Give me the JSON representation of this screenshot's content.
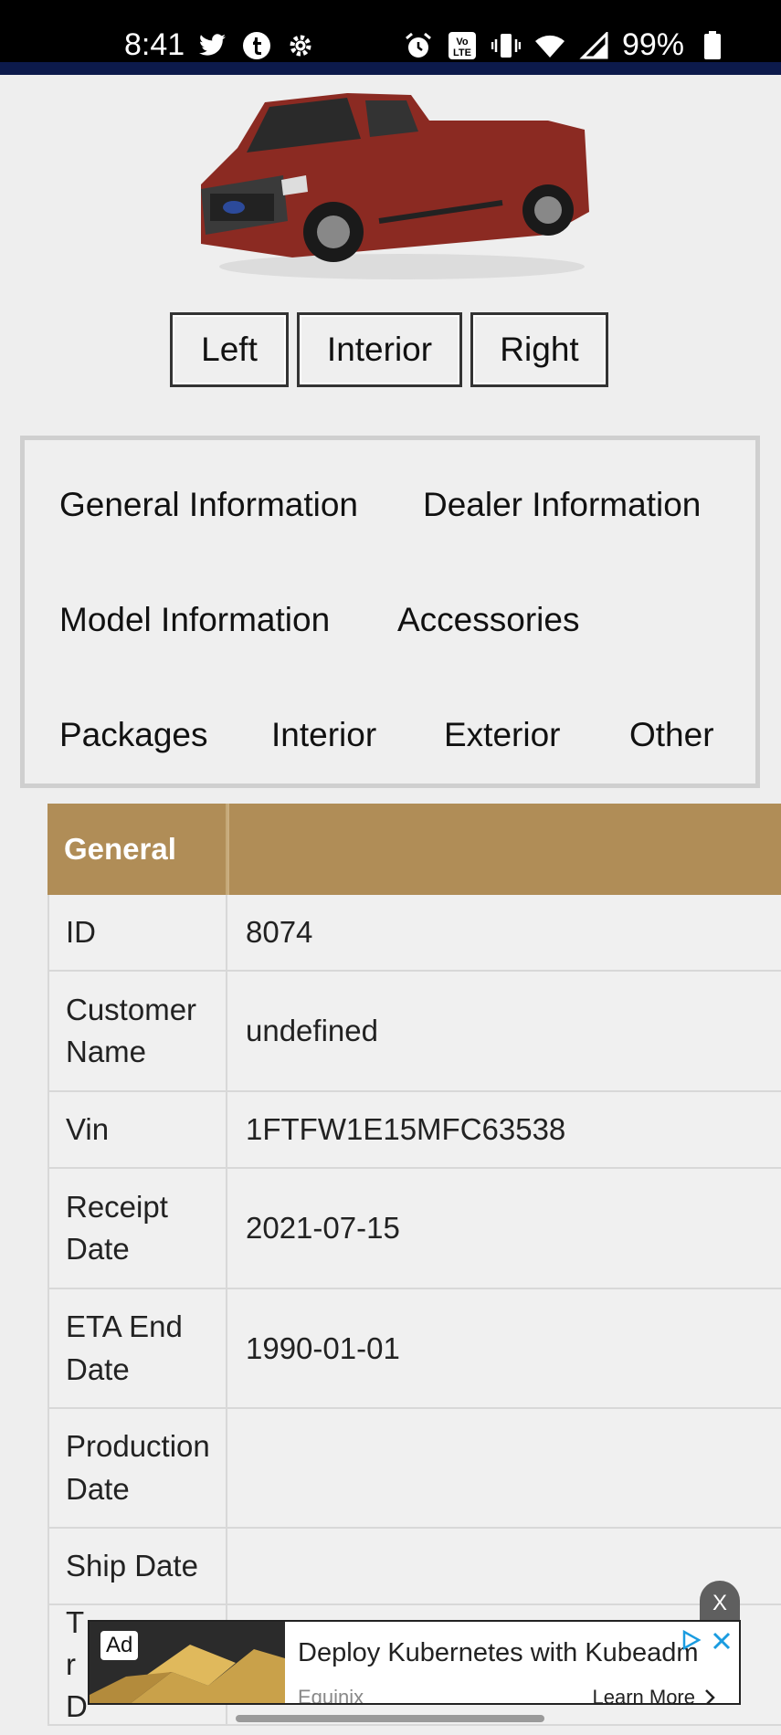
{
  "status_bar": {
    "time": "8:41",
    "left_icons": [
      "twitter-icon",
      "tumblr-icon",
      "settings-icon"
    ],
    "right_icons": [
      "alarm-icon",
      "volte-icon",
      "vibrate-icon",
      "wifi-icon",
      "signal-icon"
    ],
    "volte_text": "Vo LTE",
    "battery": "99%"
  },
  "vehicle": {
    "image_icon": "truck-image",
    "body_color": "#8b2a22"
  },
  "view_buttons": {
    "left": "Left",
    "interior": "Interior",
    "right": "Right"
  },
  "tabs": {
    "general_information": "General Information",
    "dealer_information": "Dealer Information",
    "model_information": "Model Information",
    "accessories": "Accessories",
    "packages": "Packages",
    "interior": "Interior",
    "exterior": "Exterior",
    "other": "Other"
  },
  "general_table": {
    "header": "General",
    "header_color": "#b08d57",
    "rows": [
      {
        "label": "ID",
        "value": "8074"
      },
      {
        "label": "Customer Name",
        "value": "undefined"
      },
      {
        "label": "Vin",
        "value": "1FTFW1E15MFC63538"
      },
      {
        "label": "Receipt Date",
        "value": "2021-07-15"
      },
      {
        "label": "ETA End Date",
        "value": "1990-01-01"
      },
      {
        "label": "Production Date",
        "value": ""
      },
      {
        "label": "Ship Date",
        "value": ""
      },
      {
        "label": "Tr D",
        "value": ""
      }
    ]
  },
  "ad": {
    "badge": "Ad",
    "title": "Deploy Kubernetes with Kubeadm",
    "brand": "Equinix",
    "cta": "Learn More",
    "dismiss": "X",
    "choices_icon": "adchoices-icon",
    "close_icon": "close-icon"
  }
}
